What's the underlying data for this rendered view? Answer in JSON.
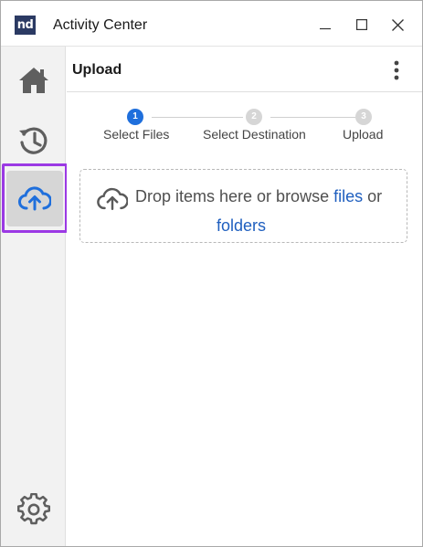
{
  "window": {
    "logo_text": "nd",
    "title": "Activity Center",
    "controls": [
      "minimize-icon",
      "maximize-icon",
      "close-icon"
    ]
  },
  "sidebar": {
    "items": [
      {
        "name": "home",
        "icon": "home-icon"
      },
      {
        "name": "history",
        "icon": "history-icon"
      },
      {
        "name": "upload",
        "icon": "cloud-upload-icon",
        "selected": true
      },
      {
        "name": "settings",
        "icon": "gear-icon"
      }
    ]
  },
  "header": {
    "title": "Upload",
    "menu_icon": "more-vertical-icon"
  },
  "stepper": {
    "steps": [
      {
        "number": "1",
        "label": "Select Files",
        "active": true
      },
      {
        "number": "2",
        "label": "Select Destination",
        "active": false
      },
      {
        "number": "3",
        "label": "Upload",
        "active": false
      }
    ]
  },
  "dropzone": {
    "icon": "cloud-upload-icon",
    "text_before": "Drop items here or browse",
    "files_link": "files",
    "text_or": "or",
    "folders_link": "folders"
  },
  "colors": {
    "accent": "#1f6fdc",
    "selection_outline": "#9b39e4",
    "link": "#1f5fbf"
  }
}
